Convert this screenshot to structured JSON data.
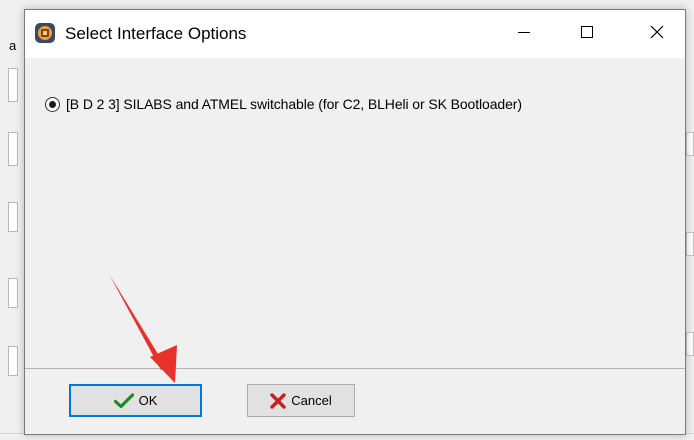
{
  "dialog": {
    "title": "Select Interface Options",
    "icon": "app-icon",
    "controls": {
      "minimize": "minimize-icon",
      "maximize": "maximize-icon",
      "close": "close-icon"
    },
    "option": {
      "label": "[B D 2 3] SILABS and ATMEL switchable (for C2,  BLHeli or SK Bootloader)",
      "selected": true
    },
    "buttons": {
      "ok_label": "OK",
      "ok_icon": "checkmark-icon",
      "cancel_label": "Cancel",
      "cancel_icon": "x-icon"
    }
  },
  "background": {
    "left_char": "a"
  },
  "colors": {
    "focus_border": "#0078d7",
    "check_green": "#1f8a1f",
    "cancel_red": "#c81e1e",
    "arrow_red": "#e8312a"
  },
  "annotation": {
    "type": "arrow",
    "points_to": "ok-button"
  }
}
